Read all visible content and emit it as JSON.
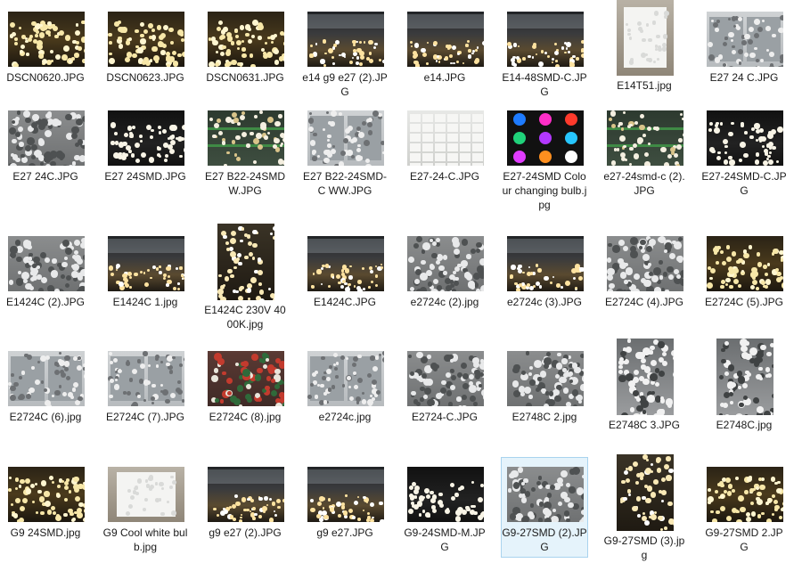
{
  "window": {
    "view": "large-icons"
  },
  "selected_index": 37,
  "files": [
    {
      "name": "DSCN0620.JPG",
      "scene": "warm-rows"
    },
    {
      "name": "DSCN0623.JPG",
      "scene": "warm-rows"
    },
    {
      "name": "DSCN0631.JPG",
      "scene": "warm-rows"
    },
    {
      "name": "e14 g9 e27 (2).JPG",
      "scene": "factory-line"
    },
    {
      "name": "e14.JPG",
      "scene": "factory-line"
    },
    {
      "name": "E14-48SMD-C.JPG",
      "scene": "factory-line"
    },
    {
      "name": "E14T51.jpg",
      "scene": "box-white"
    },
    {
      "name": "E27 24 C.JPG",
      "scene": "crate-grey"
    },
    {
      "name": "E27 24C.JPG",
      "scene": "pile-grey"
    },
    {
      "name": "E27 24SMD.JPG",
      "scene": "dark-rows-bright"
    },
    {
      "name": "E27 B22-24SMD W.JPG",
      "scene": "rack-green"
    },
    {
      "name": "E27 B22-24SMD-C WW.JPG",
      "scene": "crate-grey"
    },
    {
      "name": "E27-24-C.JPG",
      "scene": "boxes-white"
    },
    {
      "name": "E27-24SMD Colour changing bulb.jpg",
      "scene": "colour-grid"
    },
    {
      "name": "e27-24smd-c (2).JPG",
      "scene": "rack-green"
    },
    {
      "name": "E27-24SMD-C.JPG",
      "scene": "dark-rows-bright"
    },
    {
      "name": "E1424C (2).JPG",
      "scene": "pile-grey"
    },
    {
      "name": "E1424C 1.jpg",
      "scene": "factory-line"
    },
    {
      "name": "E1424C 230V 4000K.jpg",
      "scene": "tall-rows"
    },
    {
      "name": "E1424C.JPG",
      "scene": "factory-line"
    },
    {
      "name": "e2724c (2).jpg",
      "scene": "pile-grey"
    },
    {
      "name": "e2724c (3).JPG",
      "scene": "factory-line"
    },
    {
      "name": "E2724C (4).JPG",
      "scene": "pile-grey"
    },
    {
      "name": "E2724C (5).JPG",
      "scene": "warm-rows"
    },
    {
      "name": "E2724C (6).jpg",
      "scene": "crate-grey"
    },
    {
      "name": "E2724C (7).JPG",
      "scene": "crate-grey"
    },
    {
      "name": "E2724C (8).jpg",
      "scene": "pile-red"
    },
    {
      "name": "e2724c.jpg",
      "scene": "crate-grey"
    },
    {
      "name": "E2724-C.JPG",
      "scene": "pile-grey"
    },
    {
      "name": "E2748C 2.jpg",
      "scene": "pile-grey"
    },
    {
      "name": "E2748C 3.JPG",
      "scene": "pile-tall"
    },
    {
      "name": "E2748C.jpg",
      "scene": "pile-tall"
    },
    {
      "name": "G9 24SMD.jpg",
      "scene": "warm-rows"
    },
    {
      "name": "G9 Cool white bulb.jpg",
      "scene": "box-white"
    },
    {
      "name": "g9 e27 (2).JPG",
      "scene": "factory-line"
    },
    {
      "name": "g9 e27.JPG",
      "scene": "factory-line"
    },
    {
      "name": "G9-24SMD-M.JPG",
      "scene": "dark-rows-bright"
    },
    {
      "name": "G9-27SMD (2).JPG",
      "scene": "pile-grey"
    },
    {
      "name": "G9-27SMD (3).jpg",
      "scene": "tall-rows"
    },
    {
      "name": "G9-27SMD 2.JPG",
      "scene": "warm-rows"
    }
  ],
  "colors": {
    "selection_bg": "#e5f3fb",
    "selection_border": "#a9d3ee",
    "label": "#1a1a1a"
  }
}
